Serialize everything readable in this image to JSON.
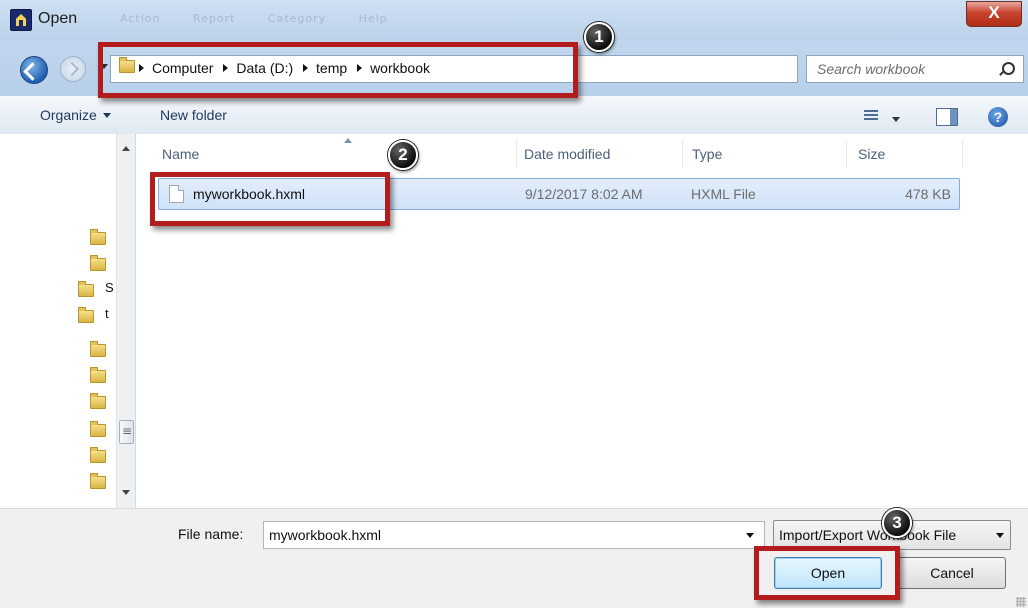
{
  "window": {
    "title": "Open",
    "close_label": "X",
    "ghost_menu": [
      "Action",
      "Report",
      "Category",
      "Help"
    ]
  },
  "address": {
    "crumbs": [
      "Computer",
      "Data (D:)",
      "temp",
      "workbook"
    ],
    "refresh_icon": "refresh-icon"
  },
  "search": {
    "placeholder": "Search workbook"
  },
  "toolbar": {
    "organize_label": "Organize",
    "new_folder_label": "New folder"
  },
  "nav": {
    "items": [
      {
        "label": ""
      },
      {
        "label": ""
      },
      {
        "label": "S"
      },
      {
        "label": "t"
      },
      {
        "label": ""
      },
      {
        "label": ""
      },
      {
        "label": ""
      },
      {
        "label": ""
      },
      {
        "label": ""
      },
      {
        "label": ""
      }
    ]
  },
  "columns": {
    "name": "Name",
    "date": "Date modified",
    "type": "Type",
    "size": "Size"
  },
  "files": [
    {
      "name": "myworkbook.hxml",
      "date": "9/12/2017 8:02 AM",
      "type": "HXML File",
      "size": "478 KB"
    }
  ],
  "bottom": {
    "filename_label": "File name:",
    "filename_value": "myworkbook.hxml",
    "filter_label": "Import/Export Workbook File",
    "open_label": "Open",
    "cancel_label": "Cancel"
  },
  "callouts": [
    "1",
    "2",
    "3"
  ],
  "colors": {
    "callout": "#b21c1c",
    "selection": "#cfe2f8",
    "chrome": "#c9dcef"
  }
}
